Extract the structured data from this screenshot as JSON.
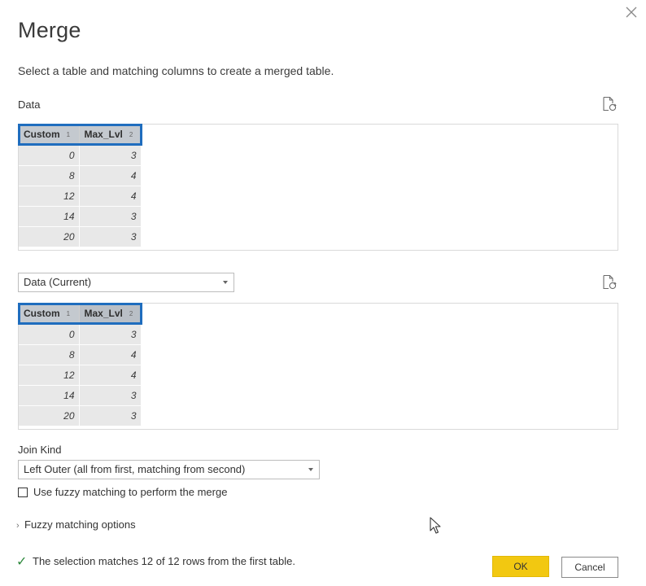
{
  "dialog": {
    "title": "Merge",
    "subtitle": "Select a table and matching columns to create a merged table.",
    "close_icon": "close-icon"
  },
  "first_table": {
    "label": "Data",
    "refresh_icon": "refresh-file-icon",
    "columns": [
      {
        "name": "Custom",
        "index": "1"
      },
      {
        "name": "Max_Lvl",
        "index": "2"
      }
    ],
    "rows": [
      [
        "0",
        "3"
      ],
      [
        "8",
        "4"
      ],
      [
        "12",
        "4"
      ],
      [
        "14",
        "3"
      ],
      [
        "20",
        "3"
      ]
    ]
  },
  "second_table": {
    "selected_table": "Data (Current)",
    "refresh_icon": "refresh-file-icon",
    "columns": [
      {
        "name": "Custom",
        "index": "1"
      },
      {
        "name": "Max_Lvl",
        "index": "2"
      }
    ],
    "rows": [
      [
        "0",
        "3"
      ],
      [
        "8",
        "4"
      ],
      [
        "12",
        "4"
      ],
      [
        "14",
        "3"
      ],
      [
        "20",
        "3"
      ]
    ]
  },
  "join": {
    "label": "Join Kind",
    "selected": "Left Outer (all from first, matching from second)"
  },
  "fuzzy": {
    "checkbox_label": "Use fuzzy matching to perform the merge",
    "checked": false,
    "options_label": "Fuzzy matching options"
  },
  "status": {
    "icon": "checkmark-icon",
    "text": "The selection matches 12 of 12 rows from the first table."
  },
  "buttons": {
    "ok": "OK",
    "cancel": "Cancel"
  },
  "colors": {
    "highlight": "#1f6dbe",
    "ok_button": "#f2c811",
    "check": "#2f8a3e"
  }
}
